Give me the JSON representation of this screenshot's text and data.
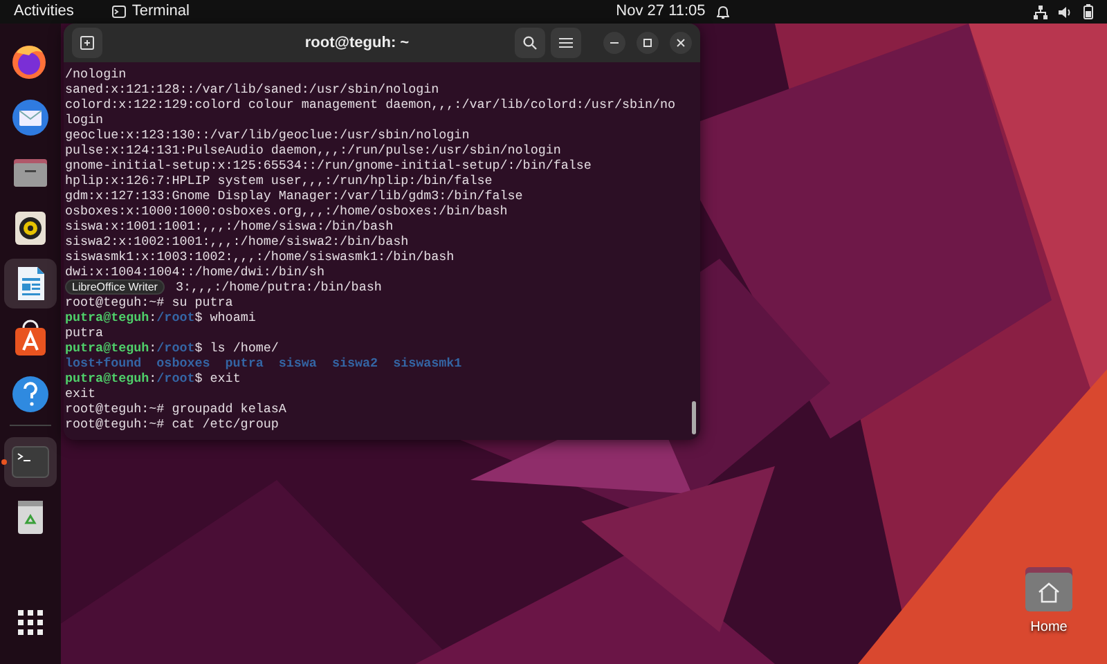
{
  "top_bar": {
    "activities": "Activities",
    "app_name": "Terminal",
    "clock": "Nov 27  11:05"
  },
  "dock": {
    "items": [
      {
        "kind": "firefox",
        "highlighted": false,
        "running": false
      },
      {
        "kind": "mail",
        "highlighted": false,
        "running": false
      },
      {
        "kind": "files",
        "highlighted": false,
        "running": false
      },
      {
        "kind": "music",
        "highlighted": false,
        "running": false
      },
      {
        "kind": "writer",
        "highlighted": true,
        "running": false
      },
      {
        "kind": "store",
        "highlighted": false,
        "running": false
      },
      {
        "kind": "help",
        "highlighted": false,
        "running": false
      },
      {
        "kind": "separator"
      },
      {
        "kind": "terminal",
        "highlighted": true,
        "running": true
      },
      {
        "kind": "trash",
        "highlighted": false,
        "running": false
      }
    ],
    "tooltip": "LibreOffice Writer"
  },
  "terminal": {
    "title": "root@teguh: ~",
    "lines": [
      {
        "segments": [
          {
            "kind": "plain",
            "text": "/nologin"
          }
        ]
      },
      {
        "segments": [
          {
            "kind": "plain",
            "text": "saned:x:121:128::/var/lib/saned:/usr/sbin/nologin"
          }
        ]
      },
      {
        "segments": [
          {
            "kind": "plain",
            "text": "colord:x:122:129:colord colour management daemon,,,:/var/lib/colord:/usr/sbin/no"
          }
        ]
      },
      {
        "segments": [
          {
            "kind": "plain",
            "text": "login"
          }
        ]
      },
      {
        "segments": [
          {
            "kind": "plain",
            "text": "geoclue:x:123:130::/var/lib/geoclue:/usr/sbin/nologin"
          }
        ]
      },
      {
        "segments": [
          {
            "kind": "plain",
            "text": "pulse:x:124:131:PulseAudio daemon,,,:/run/pulse:/usr/sbin/nologin"
          }
        ]
      },
      {
        "segments": [
          {
            "kind": "plain",
            "text": "gnome-initial-setup:x:125:65534::/run/gnome-initial-setup/:/bin/false"
          }
        ]
      },
      {
        "segments": [
          {
            "kind": "plain",
            "text": "hplip:x:126:7:HPLIP system user,,,:/run/hplip:/bin/false"
          }
        ]
      },
      {
        "segments": [
          {
            "kind": "plain",
            "text": "gdm:x:127:133:Gnome Display Manager:/var/lib/gdm3:/bin/false"
          }
        ]
      },
      {
        "segments": [
          {
            "kind": "plain",
            "text": "osboxes:x:1000:1000:osboxes.org,,,:/home/osboxes:/bin/bash"
          }
        ]
      },
      {
        "segments": [
          {
            "kind": "plain",
            "text": "siswa:x:1001:1001:,,,:/home/siswa:/bin/bash"
          }
        ]
      },
      {
        "segments": [
          {
            "kind": "plain",
            "text": "siswa2:x:1002:1001:,,,:/home/siswa2:/bin/bash"
          }
        ]
      },
      {
        "segments": [
          {
            "kind": "plain",
            "text": "siswasmk1:x:1003:1002:,,,:/home/siswasmk1:/bin/bash"
          }
        ]
      },
      {
        "segments": [
          {
            "kind": "plain",
            "text": "dwi:x:1004:1004::/home/dwi:/bin/sh"
          }
        ]
      },
      {
        "segments": [
          {
            "kind": "covered",
            "text": "3:,,,:/home/putra:/bin/bash"
          }
        ]
      },
      {
        "segments": [
          {
            "kind": "plain",
            "text": "root@teguh:~# su putra"
          }
        ]
      },
      {
        "segments": [
          {
            "kind": "user",
            "text": "putra@teguh"
          },
          {
            "kind": "plain",
            "text": ":"
          },
          {
            "kind": "path",
            "text": "/root"
          },
          {
            "kind": "plain",
            "text": "$ whoami"
          }
        ]
      },
      {
        "segments": [
          {
            "kind": "plain",
            "text": "putra"
          }
        ]
      },
      {
        "segments": [
          {
            "kind": "user",
            "text": "putra@teguh"
          },
          {
            "kind": "plain",
            "text": ":"
          },
          {
            "kind": "path",
            "text": "/root"
          },
          {
            "kind": "plain",
            "text": "$ ls /home/"
          }
        ]
      },
      {
        "segments": [
          {
            "kind": "dir",
            "text": "lost+found  osboxes  putra  siswa  siswa2  siswasmk1"
          }
        ]
      },
      {
        "segments": [
          {
            "kind": "user",
            "text": "putra@teguh"
          },
          {
            "kind": "plain",
            "text": ":"
          },
          {
            "kind": "path",
            "text": "/root"
          },
          {
            "kind": "plain",
            "text": "$ exit"
          }
        ]
      },
      {
        "segments": [
          {
            "kind": "plain",
            "text": "exit"
          }
        ]
      },
      {
        "segments": [
          {
            "kind": "plain",
            "text": "root@teguh:~# groupadd kelasA"
          }
        ]
      },
      {
        "segments": [
          {
            "kind": "plain",
            "text": "root@teguh:~# cat /etc/group"
          }
        ]
      }
    ]
  },
  "desktop_icons": [
    {
      "label": "Home"
    }
  ]
}
